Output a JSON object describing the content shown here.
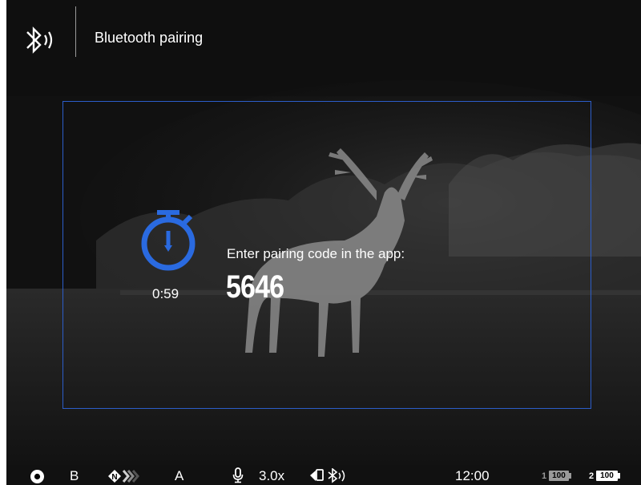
{
  "header": {
    "icon": "bluetooth-wireless-icon",
    "title": "Bluetooth pairing"
  },
  "dialog": {
    "timer_icon": "stopwatch-icon",
    "timer": "0:59",
    "prompt": "Enter pairing code in the app:",
    "code": "5646",
    "accent_color": "#2a6ae0",
    "border_color": "#2c5dc9"
  },
  "status_bar": {
    "record_icon": "record-icon",
    "mode_b": "B",
    "nav_icon": "nav-n-chevrons-icon",
    "mode_a": "A",
    "mic_icon": "microphone-icon",
    "zoom": "3.0x",
    "wifi_bt_icon": "device-wifi-bluetooth-icon",
    "clock": "12:00",
    "battery1_index": "1",
    "battery1_value": "100",
    "battery2_index": "2",
    "battery2_value": "100"
  }
}
